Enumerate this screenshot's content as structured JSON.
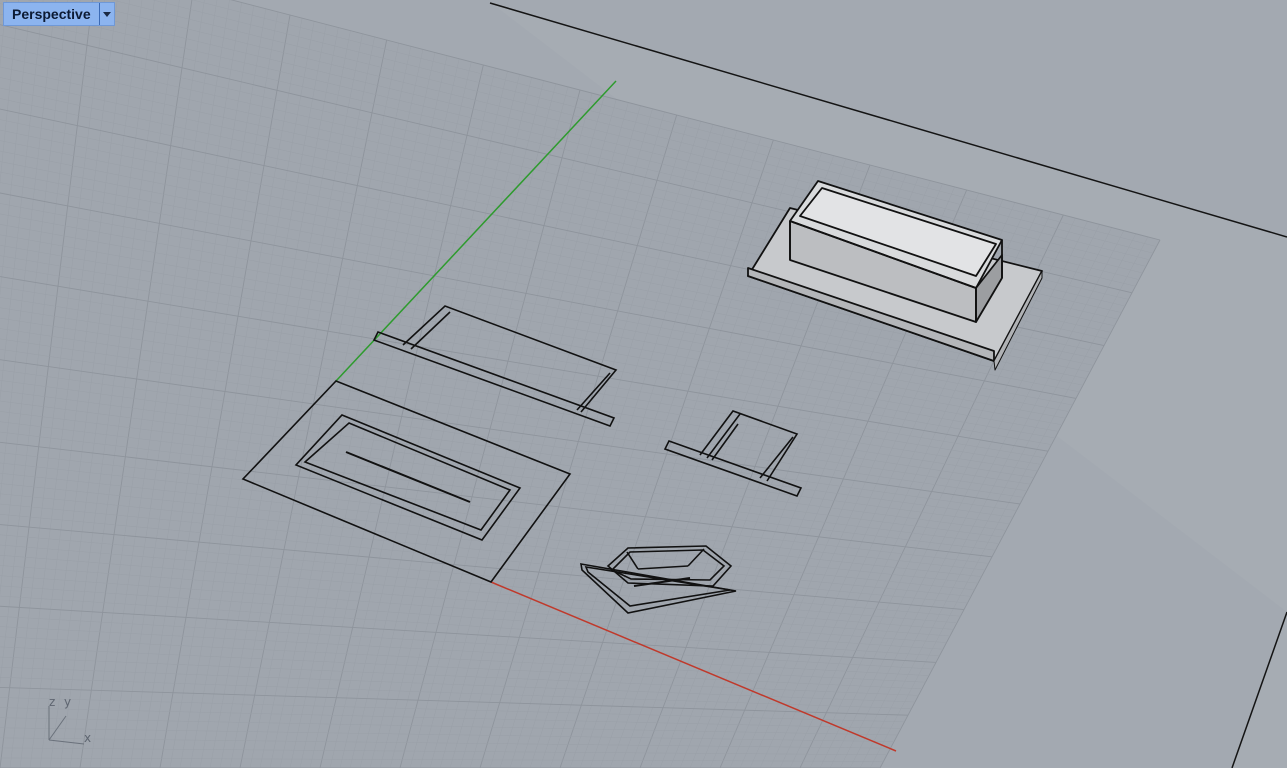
{
  "viewport": {
    "title": "Perspective",
    "dropdown_icon": "chevron-down-icon",
    "colors": {
      "background": "#a3a9b1",
      "grid_minor": "#9aa0a8",
      "grid_major": "#8e949c",
      "x_axis": "#c0392b",
      "y_axis": "#2e9b2e",
      "tab_bg": "#8cb4ef"
    }
  },
  "axis_widget": {
    "z_label": "z",
    "y_label": "y",
    "x_label": "x"
  }
}
